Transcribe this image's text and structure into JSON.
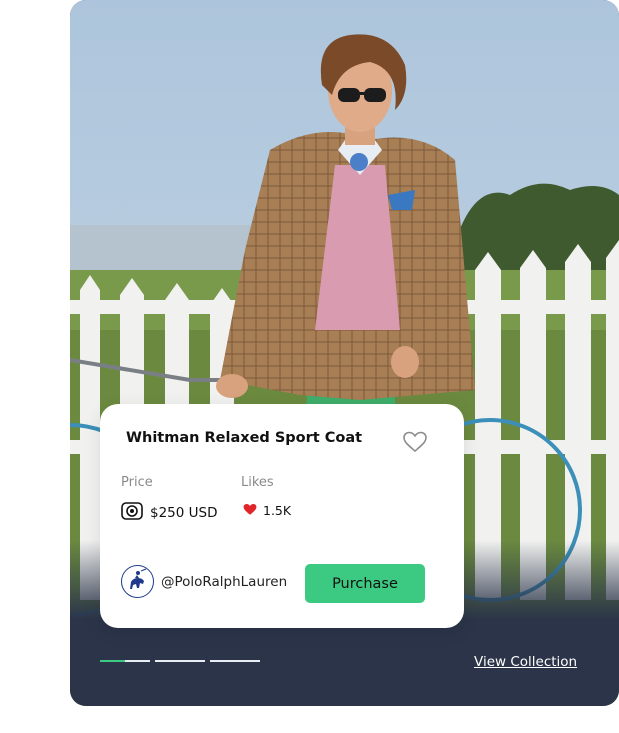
{
  "product": {
    "title": "Whitman Relaxed Sport Coat",
    "price_label": "Price",
    "price_value": "$250 USD",
    "likes_label": "Likes",
    "likes_value": "1.5K",
    "brand_handle": "@PoloRalphLauren",
    "purchase_label": "Purchase"
  },
  "footer": {
    "view_collection_label": "View Collection"
  },
  "carousel": {
    "slide_count": 3,
    "active_index": 0,
    "active_progress": 0.5
  },
  "icons": {
    "favorite": "heart-outline-icon",
    "currency": "coin-icon",
    "likes": "heart-filled-icon",
    "brand_logo": "polo-player-icon"
  },
  "colors": {
    "accent": "#3cc981",
    "card_footer": "#2b3449",
    "like_heart": "#e0262b"
  }
}
